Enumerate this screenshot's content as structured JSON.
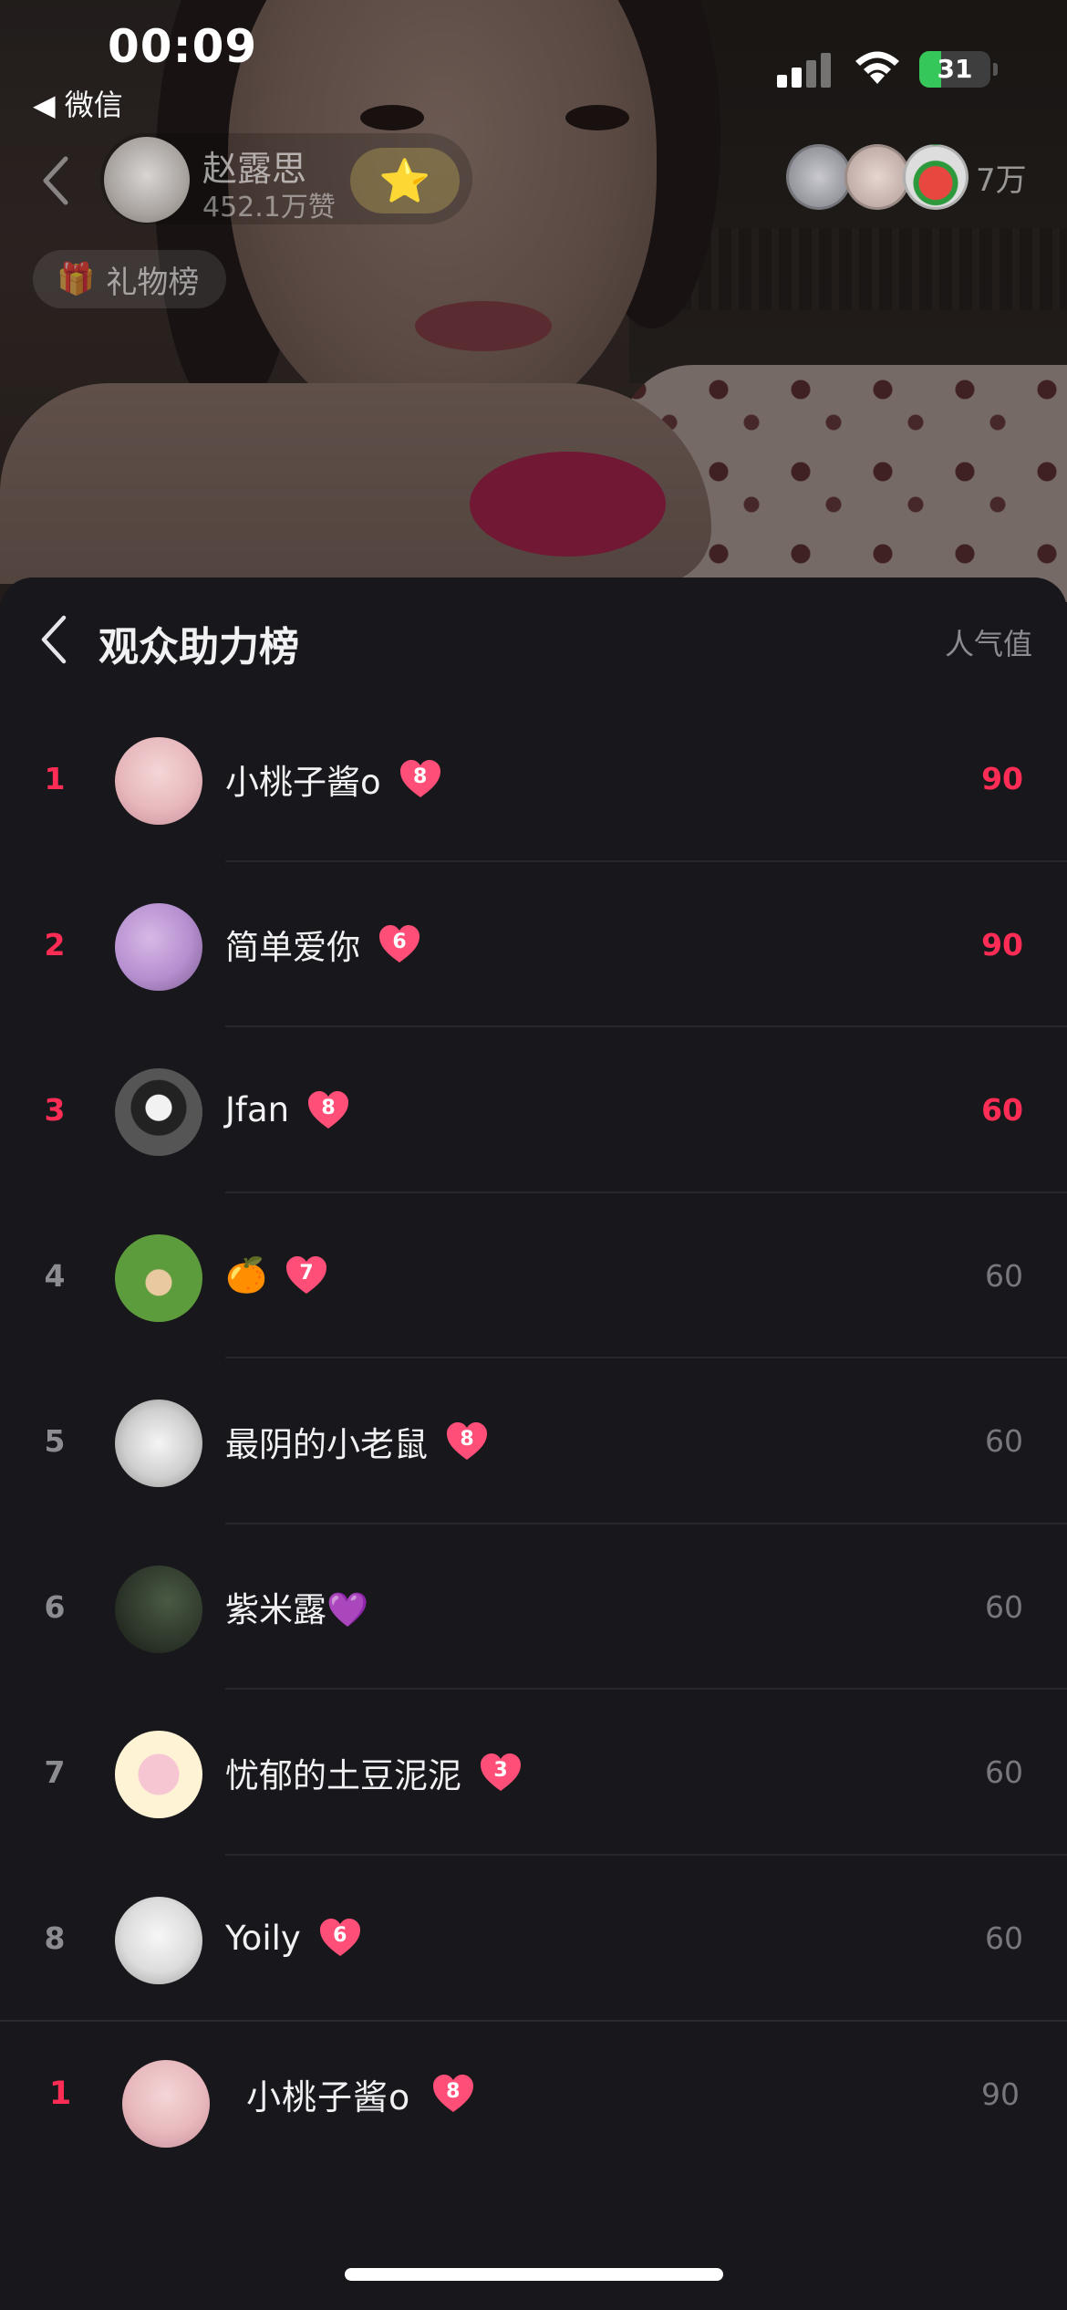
{
  "status_bar": {
    "time": "00:09",
    "back_app": "◀ 微信",
    "battery": "31"
  },
  "live": {
    "host_name": "赵露思",
    "host_likes": "452.1万赞",
    "follow_icon": "star-icon",
    "viewer_count": "7万",
    "gift_rank_label": "礼物榜"
  },
  "sheet": {
    "title": "观众助力榜",
    "metric_label": "人气值"
  },
  "ranking": [
    {
      "rank": "1",
      "name": "小桃子酱o",
      "level": "8",
      "value": "90",
      "top": true
    },
    {
      "rank": "2",
      "name": "简单爱你",
      "level": "6",
      "value": "90",
      "top": true
    },
    {
      "rank": "3",
      "name": "Jfan",
      "level": "8",
      "value": "60",
      "top": true
    },
    {
      "rank": "4",
      "name": "🍊",
      "level": "7",
      "value": "60",
      "top": false
    },
    {
      "rank": "5",
      "name": "最阴的小老鼠",
      "level": "8",
      "value": "60",
      "top": false
    },
    {
      "rank": "6",
      "name": "紫米露💜",
      "level": "",
      "value": "60",
      "top": false
    },
    {
      "rank": "7",
      "name": "忧郁的土豆泥泥",
      "level": "3",
      "value": "60",
      "top": false
    },
    {
      "rank": "8",
      "name": "Yoily",
      "level": "6",
      "value": "60",
      "top": false
    }
  ],
  "my_rank": {
    "rank": "1",
    "name": "小桃子酱o",
    "level": "8",
    "value": "90"
  },
  "colors": {
    "accent": "#ff2d55",
    "sheet_bg": "#18181c",
    "heart": "#ff4f78"
  }
}
